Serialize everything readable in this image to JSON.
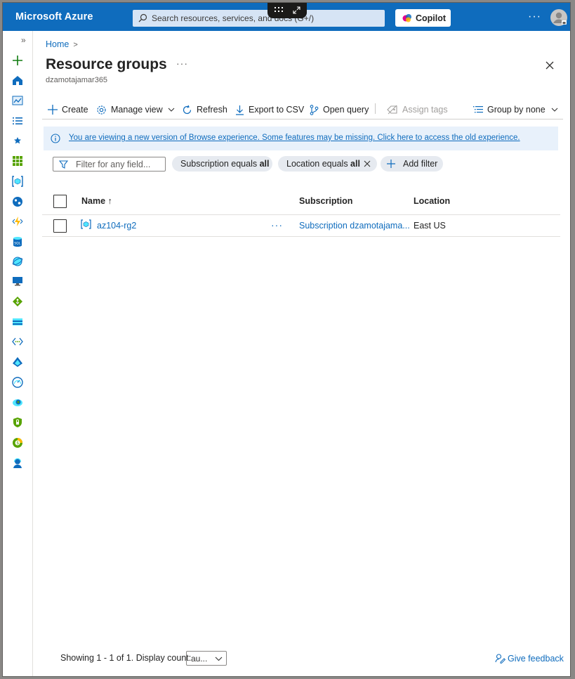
{
  "topbar": {
    "brand": "Microsoft Azure",
    "search_placeholder": "Search resources, services, and docs (G+/)",
    "copilot_label": "Copilot",
    "more": "···"
  },
  "breadcrumb": {
    "home": "Home"
  },
  "page": {
    "title": "Resource groups",
    "title_more": "···",
    "subtitle": "dzamotajamar365"
  },
  "toolbar": {
    "create": "Create",
    "manage_view": "Manage view",
    "refresh": "Refresh",
    "export_csv": "Export to CSV",
    "open_query": "Open query",
    "assign_tags": "Assign tags",
    "group_by": "Group by none"
  },
  "banner": {
    "text": "You are viewing a new version of Browse experience. Some features may be missing. Click here to access the old experience."
  },
  "filters": {
    "placeholder": "Filter for any field...",
    "subscription_prefix": "Subscription equals ",
    "subscription_value": "all",
    "location_prefix": "Location equals ",
    "location_value": "all",
    "add_filter": "Add filter"
  },
  "table": {
    "columns": {
      "name": "Name ↑",
      "subscription": "Subscription",
      "location": "Location"
    },
    "rows": [
      {
        "name": "az104-rg2",
        "more": "···",
        "subscription": "Subscription dzamotajama...",
        "location": "East US"
      }
    ]
  },
  "footer": {
    "showing": "Showing 1 - 1 of 1. Display count:",
    "display_count": "au...",
    "feedback": "Give feedback"
  },
  "colors": {
    "accent": "#0f6cbd",
    "topbar": "#0f6cbd",
    "banner_bg": "#e8f1fb"
  }
}
